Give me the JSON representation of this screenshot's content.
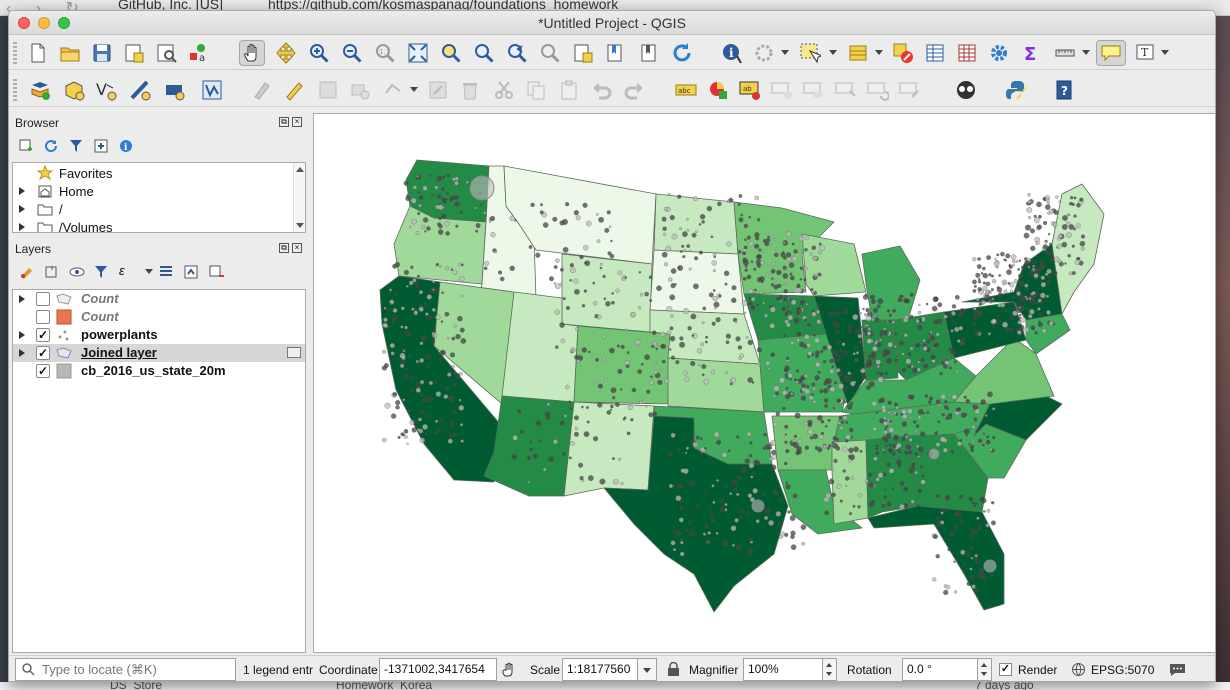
{
  "background_browser": {
    "tab_text": "GitHub, Inc. [US]",
    "url_text": "https://github.com/kosmaspanag/foundations_homework",
    "bottom_items": [
      "DS_Store",
      "Homework_Korea",
      "7 days ago"
    ]
  },
  "window": {
    "title": "*Untitled Project - QGIS"
  },
  "toolbar1": {
    "icons": [
      "new-project-icon",
      "open-project-icon",
      "save-project-icon",
      "save-as-icon",
      "print-layout-icon",
      "style-manager-icon",
      "pan-icon",
      "pan-to-selection-icon",
      "zoom-in-icon",
      "zoom-out-icon",
      "zoom-native-icon",
      "zoom-full-icon",
      "zoom-selection-icon",
      "zoom-layer-icon",
      "zoom-last-icon",
      "zoom-next-icon",
      "new-bookmark-icon",
      "show-bookmarks-icon",
      "refresh-icon",
      "identify-icon",
      "run-action-icon",
      "select-features-icon",
      "attribute-table-icon",
      "deselect-icon",
      "open-table-icon",
      "field-calculator-icon",
      "settings-icon",
      "statistics-icon",
      "measure-icon",
      "map-tips-icon",
      "text-annotation-icon"
    ]
  },
  "toolbar2": {
    "icons": [
      "data-source-manager-icon",
      "new-geopackage-icon",
      "new-shapefile-icon",
      "new-spatialite-icon",
      "new-virtual-layer-icon",
      "digitize-icon",
      "current-edits-icon",
      "toggle-editing-icon",
      "save-edits-icon",
      "add-feature-icon",
      "vertex-tool-icon",
      "modify-attributes-icon",
      "delete-selected-icon",
      "cut-features-icon",
      "copy-features-icon",
      "paste-features-icon",
      "undo-icon",
      "redo-icon",
      "label-toolbar-icon",
      "diagram-options-icon",
      "highlight-pinned-icon",
      "pin-label-icon",
      "show-hide-labels-icon",
      "move-label-icon",
      "rotate-label-icon",
      "change-label-icon",
      "plugin-manager-icon",
      "python-console-icon",
      "help-icon"
    ]
  },
  "browser_panel": {
    "title": "Browser",
    "items": [
      {
        "label": "Favorites",
        "icon": "star-icon",
        "expandable": false
      },
      {
        "label": "Home",
        "icon": "home-icon",
        "expandable": true
      },
      {
        "label": "/",
        "icon": "folder-icon",
        "expandable": true
      },
      {
        "label": "/Volumes",
        "icon": "folder-icon",
        "expandable": true
      }
    ]
  },
  "layers_panel": {
    "title": "Layers",
    "layers": [
      {
        "label": "Count",
        "checked": false,
        "icon": "polygon-group-icon",
        "expandable": true,
        "active": false
      },
      {
        "label": "Count",
        "checked": false,
        "icon": "fill-symbol-icon",
        "expandable": false,
        "active": false
      },
      {
        "label": "powerplants",
        "checked": true,
        "icon": "point-layer-icon",
        "expandable": true,
        "active": true
      },
      {
        "label": "Joined layer",
        "checked": true,
        "icon": "polygon-layer-icon",
        "expandable": true,
        "active": true,
        "selected": true
      },
      {
        "label": "cb_2016_us_state_20m",
        "checked": true,
        "icon": "gray-fill-icon",
        "expandable": false,
        "active": true
      }
    ]
  },
  "statusbar": {
    "locate_placeholder": "Type to locate (⌘K)",
    "legend_text": "1 legend entr",
    "coordinate_label": "Coordinate",
    "coordinate_value": "-1371002,3417654",
    "scale_label": "Scale",
    "scale_value": "1:18177560",
    "magnifier_label": "Magnifier",
    "magnifier_value": "100%",
    "rotation_label": "Rotation",
    "rotation_value": "0.0 °",
    "render_label": "Render",
    "render_checked": true,
    "crs_label": "EPSG:5070"
  },
  "colors": {
    "choropleth_ramp": [
      "#edf8e9",
      "#c7e9c0",
      "#a1d99b",
      "#74c476",
      "#41ab5d",
      "#238b45",
      "#005a32"
    ],
    "point_fill": "#444444"
  }
}
